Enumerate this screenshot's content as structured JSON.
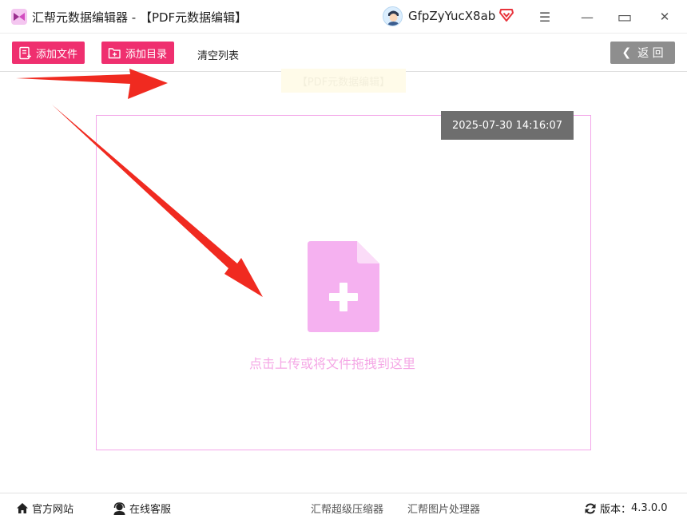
{
  "titlebar": {
    "app_title": "汇帮元数据编辑器 - 【PDF元数据编辑】",
    "username": "GfpZyYucX8ab",
    "menu_icon": "☰",
    "minimize_icon": "—",
    "maximize_icon": "▭",
    "close_icon": "✕"
  },
  "toolbar": {
    "add_file_label": "添加文件",
    "add_folder_label": "添加目录",
    "clear_list_label": "清空列表",
    "back_label": "返 回"
  },
  "faded_label": "【PDF元数据编辑】",
  "dropzone": {
    "timestamp": "2025-07-30 14:16:07",
    "hint": "点击上传或将文件拖拽到这里"
  },
  "footer": {
    "official_site": "官方网站",
    "online_service": "在线客服",
    "link_compressor": "汇帮超级压缩器",
    "link_image_tool": "汇帮图片处理器",
    "version_label": "版本：",
    "version_value": "4.3.0.0"
  },
  "colors": {
    "accent_pink": "#ef2f6f",
    "dropzone_border": "#f3a6e9",
    "upload_icon": "#f5b1f0",
    "annotation_red": "#f02a20",
    "back_button": "#8e8e8e"
  },
  "icons": [
    "app-logo-icon",
    "avatar-icon",
    "vip-diamond-icon",
    "menu-icon",
    "minimize-icon",
    "maximize-icon",
    "close-icon",
    "add-file-icon",
    "add-folder-icon",
    "chevron-left-icon",
    "file-plus-icon",
    "home-icon",
    "headset-icon",
    "refresh-icon",
    "red-arrow-annotation"
  ]
}
